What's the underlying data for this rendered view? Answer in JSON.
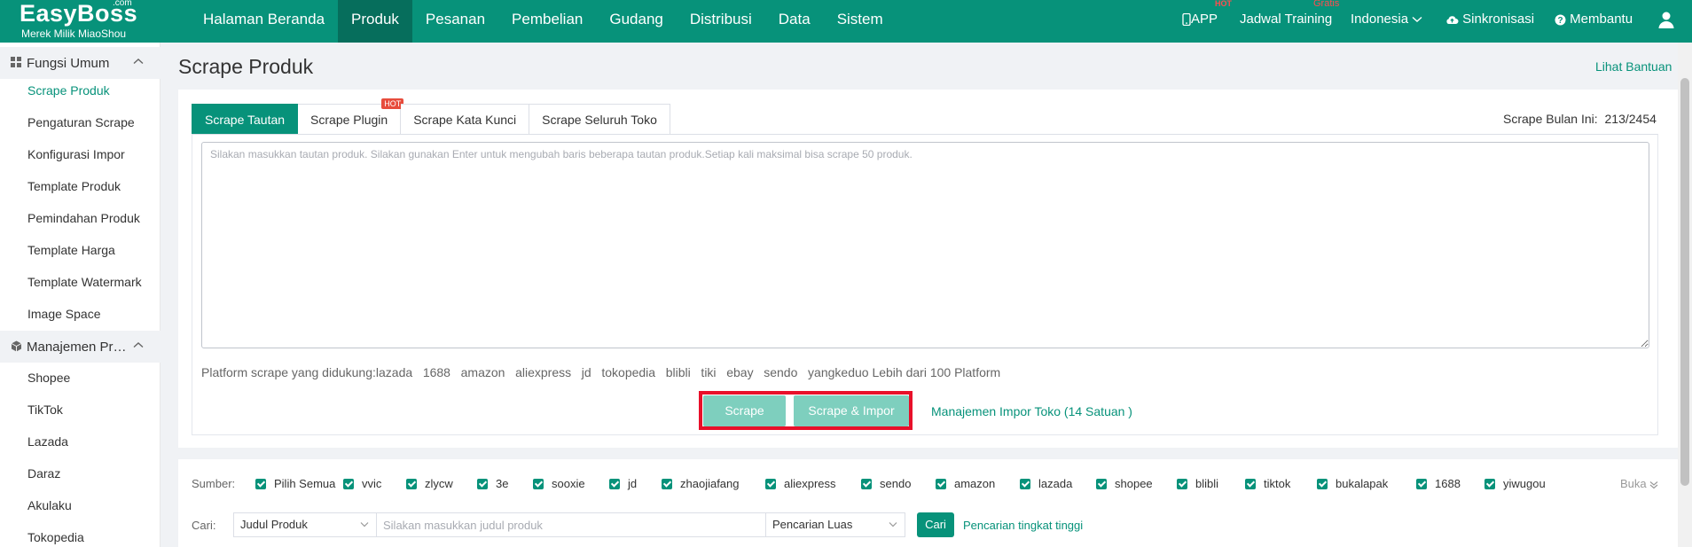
{
  "brand": {
    "name": "EasyBoss",
    "suffix": ".com",
    "tagline": "Merek Milik MiaoShou"
  },
  "nav": [
    {
      "label": "Halaman Beranda",
      "active": false
    },
    {
      "label": "Produk",
      "active": true
    },
    {
      "label": "Pesanan",
      "active": false
    },
    {
      "label": "Pembelian",
      "active": false
    },
    {
      "label": "Gudang",
      "active": false
    },
    {
      "label": "Distribusi",
      "active": false
    },
    {
      "label": "Data",
      "active": false
    },
    {
      "label": "Sistem",
      "active": false
    }
  ],
  "topright": {
    "app": "APP",
    "app_badge": "HOT",
    "training": "Jadwal Training",
    "training_badge": "Gratis",
    "language": "Indonesia",
    "sync": "Sinkronisasi",
    "help": "Membantu"
  },
  "sidebar": {
    "group1": "Fungsi Umum",
    "group1_items": [
      "Scrape Produk",
      "Pengaturan Scrape",
      "Konfigurasi Impor",
      "Template Produk",
      "Pemindahan Produk",
      "Template Harga",
      "Template Watermark",
      "Image Space"
    ],
    "group2": "Manajemen Produk",
    "group2_items": [
      "Shopee",
      "TikTok",
      "Lazada",
      "Daraz",
      "Akulaku",
      "Tokopedia"
    ]
  },
  "page": {
    "title": "Scrape Produk",
    "help_link": "Lihat Bantuan"
  },
  "tabs": [
    {
      "label": "Scrape Tautan",
      "active": true
    },
    {
      "label": "Scrape Plugin",
      "badge": "HOT"
    },
    {
      "label": "Scrape Kata Kunci"
    },
    {
      "label": "Scrape Seluruh Toko"
    }
  ],
  "counter": {
    "label": "Scrape Bulan Ini:",
    "value": "213/2454"
  },
  "scrape": {
    "placeholder": "Silakan masukkan tautan produk. Silakan gunakan Enter untuk mengubah baris beberapa tautan produk.Setiap kali maksimal bisa scrape 50 produk.",
    "platforms": "Platform scrape yang didukung:lazada   1688   amazon   aliexpress   jd   tokopedia   blibli   tiki   ebay   sendo   yangkeduo Lebih dari 100 Platform",
    "btn_scrape": "Scrape",
    "btn_scrape_import": "Scrape & Impor",
    "import_link": "Manajemen Impor Toko (14 Satuan )"
  },
  "filter": {
    "sumber_label": "Sumber:",
    "sources": [
      "Pilih Semua",
      "vvic",
      "zlycw",
      "3e",
      "sooxie",
      "jd",
      "zhaojiafang",
      "aliexpress",
      "sendo",
      "amazon",
      "lazada",
      "shopee",
      "blibli",
      "tiktok",
      "bukalapak",
      "1688",
      "yiwugou"
    ],
    "expand": "Buka",
    "cari_label": "Cari:",
    "field_select": "Judul Produk",
    "search_placeholder": "Silakan masukkan judul produk",
    "mode_select": "Pencarian Luas",
    "search_button": "Cari",
    "advanced_link": "Pencarian tingkat tinggi"
  },
  "colors": {
    "primary": "#07927a",
    "highlight": "#e8102a",
    "button_disabled": "#7ecfbe"
  }
}
